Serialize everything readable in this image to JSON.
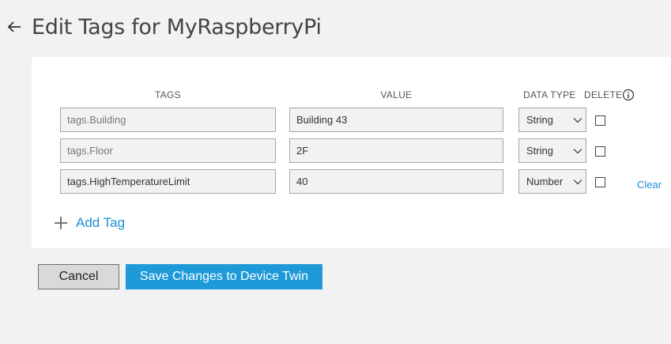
{
  "header": {
    "title": "Edit Tags for MyRaspberryPi"
  },
  "table": {
    "headers": {
      "tags": "TAGS",
      "value": "VALUE",
      "data_type": "DATA TYPE",
      "delete": "DELETE"
    },
    "rows": [
      {
        "tag": "tags.Building",
        "value": "Building 43",
        "data_type": "String",
        "delete_checked": false,
        "editable_tag": false
      },
      {
        "tag": "tags.Floor",
        "value": "2F",
        "data_type": "String",
        "delete_checked": false,
        "editable_tag": false
      },
      {
        "tag": "tags.HighTemperatureLimit",
        "value": "40",
        "data_type": "Number",
        "delete_checked": false,
        "editable_tag": true
      }
    ],
    "clear_label": "Clear"
  },
  "add_tag_label": "Add Tag",
  "buttons": {
    "cancel": "Cancel",
    "save": "Save Changes to Device Twin"
  },
  "colors": {
    "accent": "#1e9ad8",
    "link": "#1e8fd8",
    "background": "#f2f2f2"
  },
  "icons": {
    "back": "arrow-left-icon",
    "info": "info-icon",
    "add": "plus-icon",
    "dropdown": "chevron-down-icon"
  }
}
